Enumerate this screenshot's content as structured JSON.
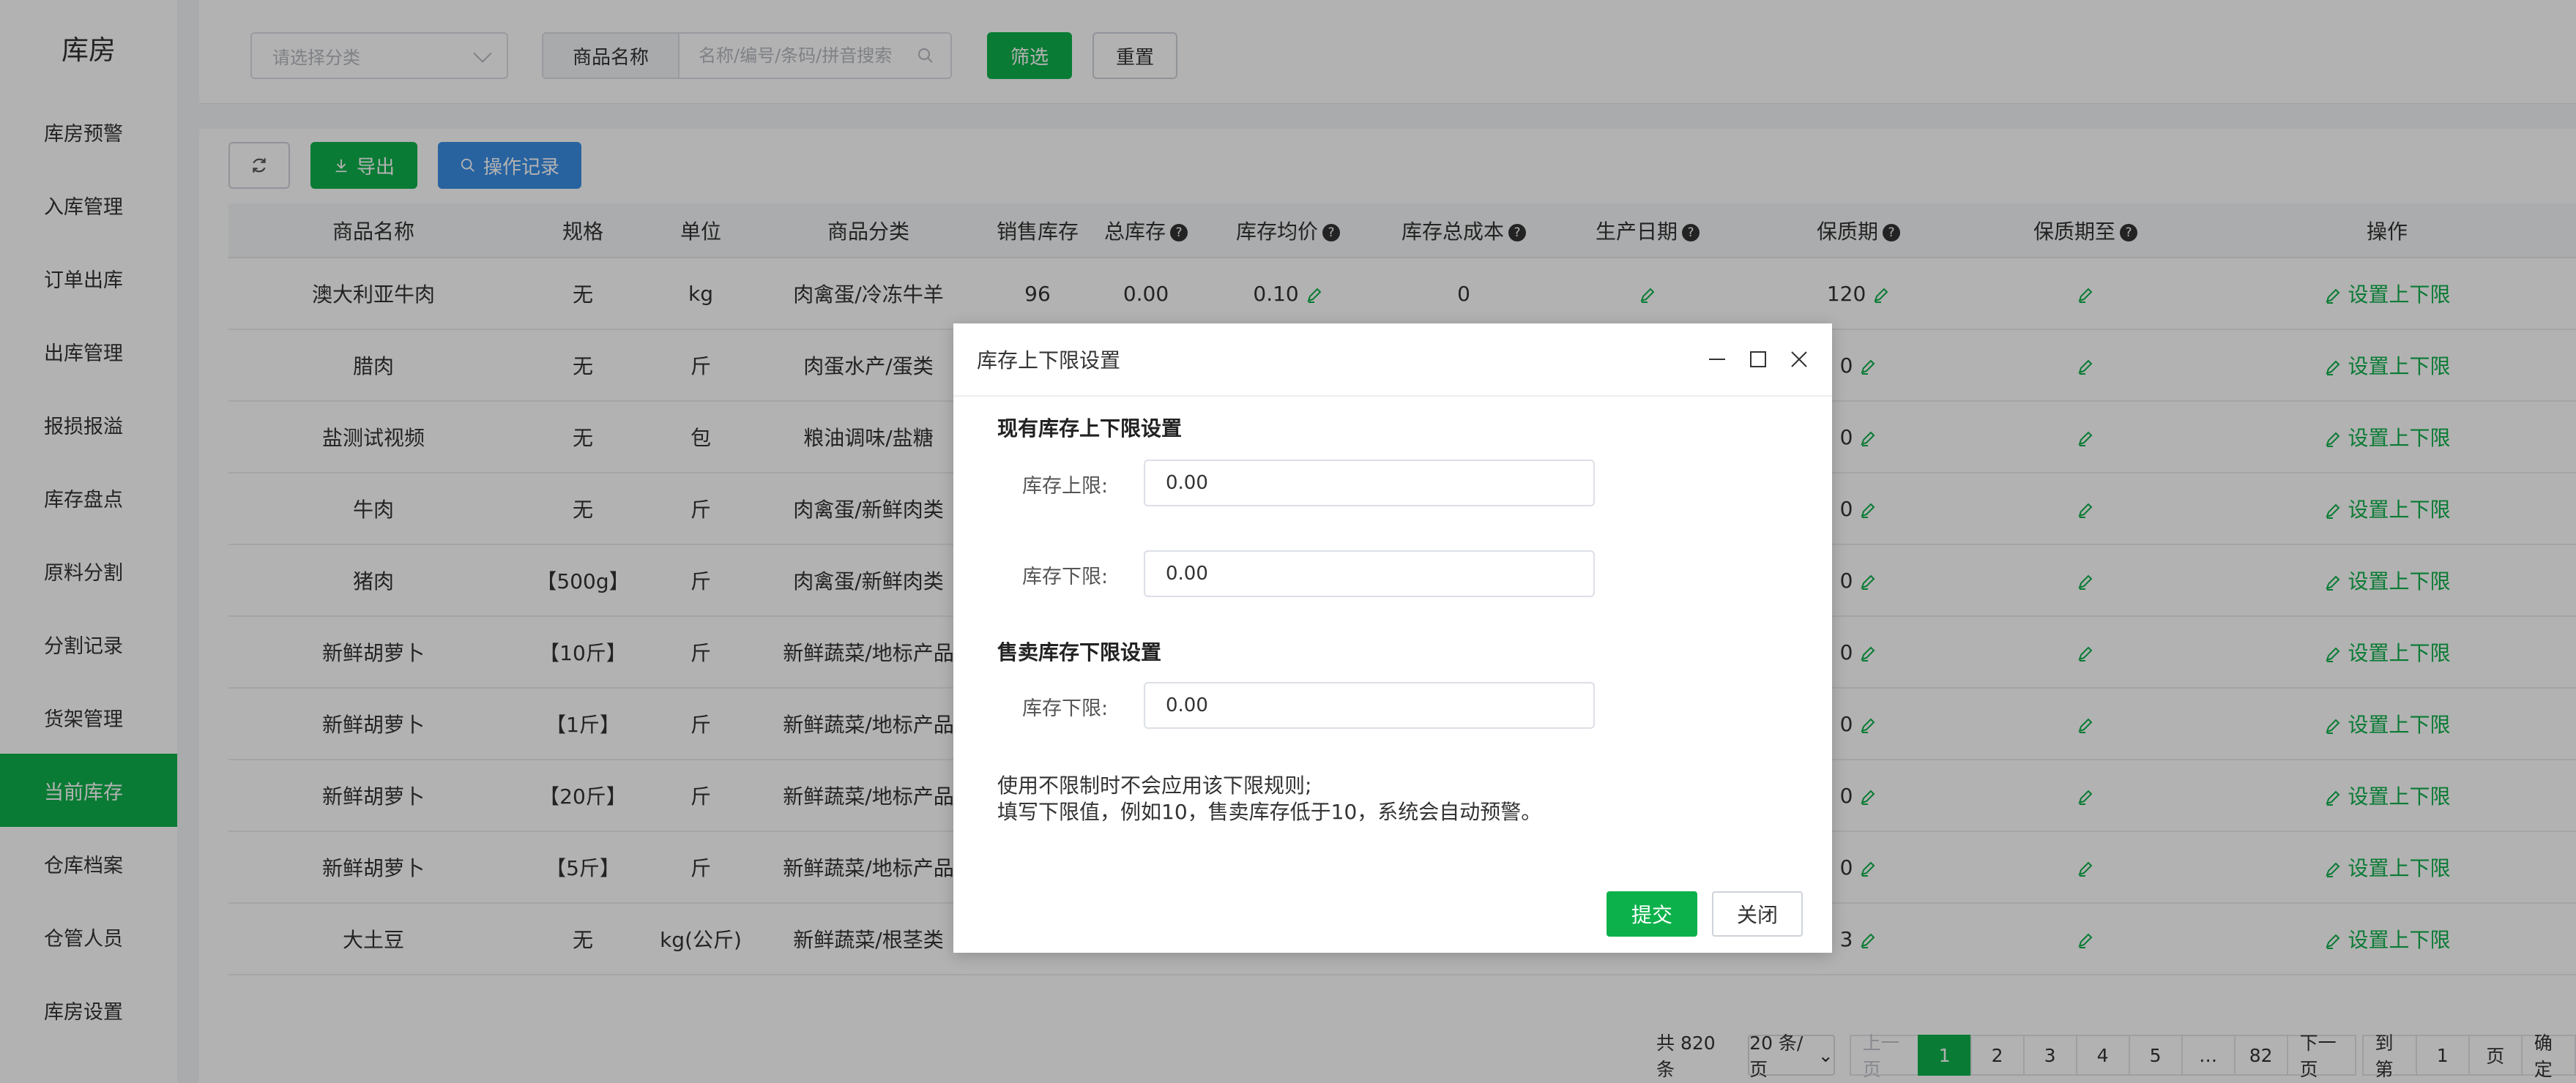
{
  "sidebar": {
    "title": "库房",
    "items": [
      {
        "label": "库房预警"
      },
      {
        "label": "入库管理"
      },
      {
        "label": "订单出库"
      },
      {
        "label": "出库管理"
      },
      {
        "label": "报损报溢"
      },
      {
        "label": "库存盘点"
      },
      {
        "label": "原料分割"
      },
      {
        "label": "分割记录"
      },
      {
        "label": "货架管理"
      },
      {
        "label": "当前库存"
      },
      {
        "label": "仓库档案"
      },
      {
        "label": "仓管人员"
      },
      {
        "label": "库房设置"
      }
    ],
    "active_index": 9
  },
  "filters": {
    "category_placeholder": "请选择分类",
    "search_label": "商品名称",
    "search_placeholder": "名称/编号/条码/拼音搜索",
    "filter_button": "筛选",
    "reset_button": "重置"
  },
  "toolbar": {
    "export_button": "导出",
    "log_button": "操作记录"
  },
  "table": {
    "headers": {
      "name": "商品名称",
      "spec": "规格",
      "unit": "单位",
      "category": "商品分类",
      "sale_stock": "销售库存",
      "total_stock": "总库存",
      "avg_price": "库存均价",
      "total_cost": "库存总成本",
      "prod_date": "生产日期",
      "shelf_life": "保质期",
      "expiry": "保质期至",
      "action": "操作"
    },
    "action_label": "设置上下限",
    "rows": [
      {
        "name": "澳大利亚牛肉",
        "spec": "无",
        "unit": "kg",
        "category": "肉禽蛋/冷冻牛羊",
        "sale_stock": "96",
        "total_stock": "0.00",
        "avg_price": "0.10",
        "total_cost": "0",
        "shelf_life": "120"
      },
      {
        "name": "腊肉",
        "spec": "无",
        "unit": "斤",
        "category": "肉蛋水产/蛋类",
        "shelf_life": "0"
      },
      {
        "name": "盐测试视频",
        "spec": "无",
        "unit": "包",
        "category": "粮油调味/盐糖",
        "shelf_life": "0"
      },
      {
        "name": "牛肉",
        "spec": "无",
        "unit": "斤",
        "category": "肉禽蛋/新鲜肉类",
        "shelf_life": "0"
      },
      {
        "name": "猪肉",
        "spec": "【500g】",
        "unit": "斤",
        "category": "肉禽蛋/新鲜肉类",
        "shelf_life": "0"
      },
      {
        "name": "新鲜胡萝卜",
        "spec": "【10斤】",
        "unit": "斤",
        "category": "新鲜蔬菜/地标产品",
        "shelf_life": "0"
      },
      {
        "name": "新鲜胡萝卜",
        "spec": "【1斤】",
        "unit": "斤",
        "category": "新鲜蔬菜/地标产品",
        "shelf_life": "0"
      },
      {
        "name": "新鲜胡萝卜",
        "spec": "【20斤】",
        "unit": "斤",
        "category": "新鲜蔬菜/地标产品",
        "shelf_life": "0"
      },
      {
        "name": "新鲜胡萝卜",
        "spec": "【5斤】",
        "unit": "斤",
        "category": "新鲜蔬菜/地标产品",
        "shelf_life": "0"
      },
      {
        "name": "大土豆",
        "spec": "无",
        "unit": "kg(公斤)",
        "category": "新鲜蔬菜/根茎类",
        "shelf_life": "3"
      }
    ]
  },
  "pager": {
    "total": "共 820 条",
    "page_size": "20 条/页",
    "prev": "上一页",
    "pages": [
      "1",
      "2",
      "3",
      "4",
      "5",
      "…",
      "82"
    ],
    "next": "下一页",
    "goto_label": "到第",
    "goto_value": "1",
    "page_suffix": "页",
    "confirm": "确定"
  },
  "modal": {
    "title": "库存上下限设置",
    "section1": "现有库存上下限设置",
    "upper_label": "库存上限:",
    "upper_value": "0.00",
    "lower_label": "库存下限:",
    "lower_value": "0.00",
    "section2": "售卖库存下限设置",
    "sale_lower_label": "库存下限:",
    "sale_lower_value": "0.00",
    "note_line1": "使用不限制时不会应用该下限规则;",
    "note_line2": "填写下限值，例如10，售卖库存低于10，系统会自动预警。",
    "submit": "提交",
    "close": "关闭"
  },
  "colors": {
    "accent": "#0db14b",
    "blue": "#3a8ee6"
  }
}
